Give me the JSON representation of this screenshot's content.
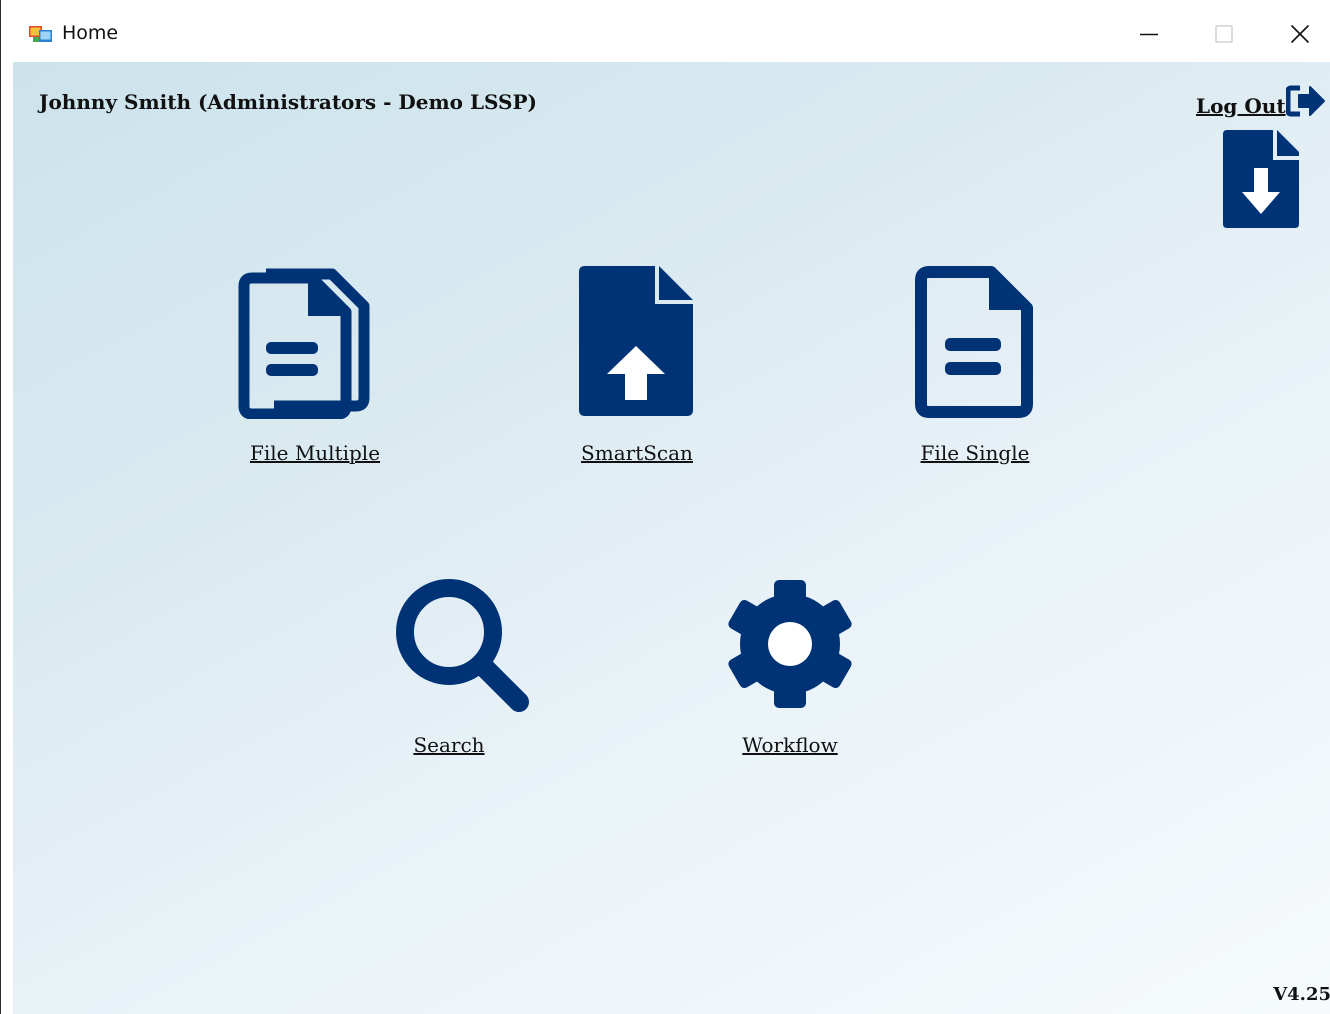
{
  "window": {
    "title": "Home"
  },
  "header": {
    "user_label": "Johnny Smith (Administrators - Demo LSSP)",
    "logout_label": "Log Out"
  },
  "tiles": [
    {
      "label": "File Multiple",
      "icon": "file-multiple-icon"
    },
    {
      "label": "SmartScan",
      "icon": "file-upload-icon"
    },
    {
      "label": "File Single",
      "icon": "file-single-icon"
    },
    {
      "label": "Search",
      "icon": "search-icon"
    },
    {
      "label": "Workflow",
      "icon": "gear-icon"
    }
  ],
  "footer": {
    "version": "V4.25"
  },
  "colors": {
    "accent": "#003376",
    "background_start": "#cce3ec",
    "background_end": "#f6fafc"
  }
}
